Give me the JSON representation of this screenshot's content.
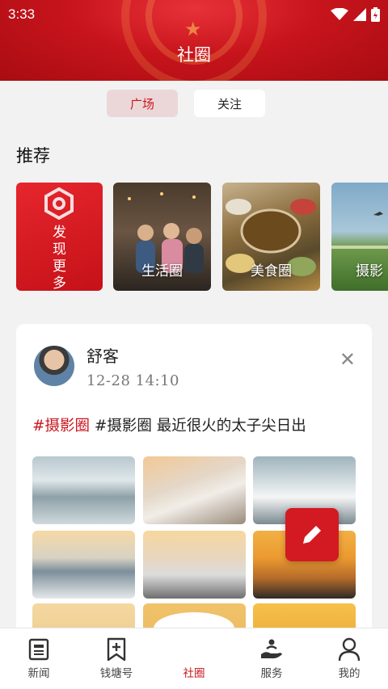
{
  "status_bar": {
    "time": "3:33"
  },
  "header": {
    "title": "社圈"
  },
  "segment_tabs": [
    {
      "label": "广场",
      "active": true
    },
    {
      "label": "关注",
      "active": false
    }
  ],
  "recommend": {
    "title": "推荐",
    "cards": [
      {
        "label": "发现更多",
        "chars": [
          "发",
          "现",
          "更",
          "多"
        ]
      },
      {
        "label": "生活圈"
      },
      {
        "label": "美食圈"
      },
      {
        "label": "摄影"
      }
    ]
  },
  "post": {
    "author": "舒客",
    "time": "12-28  14:10",
    "topic": "#摄影圈",
    "text": " #摄影圈  最近很火的太子尖日出",
    "close_icon": "close-icon"
  },
  "bottom_nav": [
    {
      "label": "新闻",
      "icon": "newspaper-icon",
      "active": false
    },
    {
      "label": "钱塘号",
      "icon": "bookmark-plus-icon",
      "active": false
    },
    {
      "label": "社圈",
      "icon": "community-icon",
      "active": true
    },
    {
      "label": "服务",
      "icon": "hand-service-icon",
      "active": false
    },
    {
      "label": "我的",
      "icon": "user-icon",
      "active": false
    }
  ],
  "colors": {
    "brand_red": "#c8161d",
    "background": "#f2f2f2"
  }
}
